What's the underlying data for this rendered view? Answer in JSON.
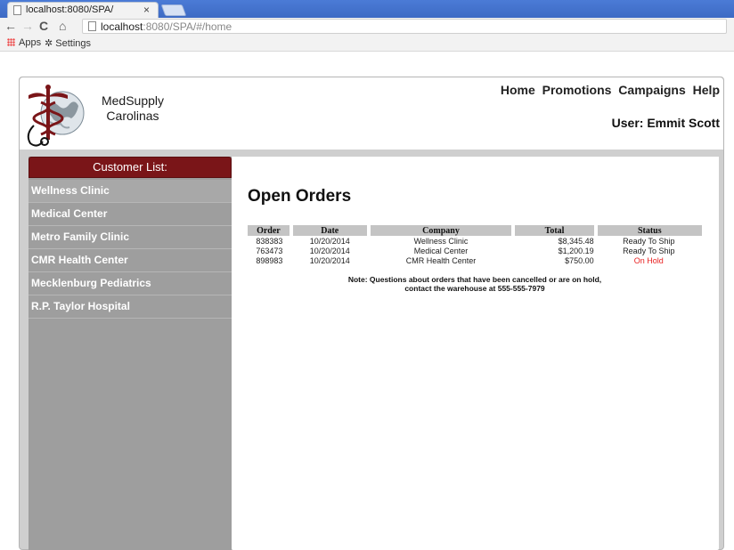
{
  "browser": {
    "tab_title": "localhost:8080/SPA/",
    "tab_close": "×",
    "url_host": "localhost",
    "url_rest": ":8080/SPA/#/home",
    "bookmarks": [
      {
        "label": "Apps",
        "icon": "apps-grid-icon"
      },
      {
        "label": "Settings",
        "icon": "gear-icon"
      }
    ]
  },
  "header": {
    "brand_line1": "MedSupply",
    "brand_line2": "Carolinas",
    "nav": [
      "Home",
      "Promotions",
      "Campaigns",
      "Help"
    ],
    "user_label": "User: Emmit Scott"
  },
  "sidebar": {
    "title": "Customer List:",
    "customers": [
      "Wellness Clinic",
      "Medical Center",
      "Metro Family Clinic",
      "CMR Health Center",
      "Mecklenburg Pediatrics",
      "R.P. Taylor Hospital"
    ]
  },
  "main": {
    "title": "Open Orders",
    "columns": [
      "Order",
      "Date",
      "Company",
      "Total",
      "Status"
    ],
    "orders": [
      {
        "order": "838383",
        "date": "10/20/2014",
        "company": "Wellness Clinic",
        "total": "$8,345.48",
        "status": "Ready To Ship"
      },
      {
        "order": "763473",
        "date": "10/20/2014",
        "company": "Medical Center",
        "total": "$1,200.19",
        "status": "Ready To Ship"
      },
      {
        "order": "898983",
        "date": "10/20/2014",
        "company": "CMR Health Center",
        "total": "$750.00",
        "status": "On Hold"
      }
    ],
    "note_line1": "Note: Questions about orders that have been cancelled or are on hold,",
    "note_line2": "contact the warehouse at 555-555-7979"
  },
  "colors": {
    "sidebar_title_bg": "#7a1518",
    "on_hold": "#e82020",
    "tabstrip": "#4b7bd6"
  }
}
